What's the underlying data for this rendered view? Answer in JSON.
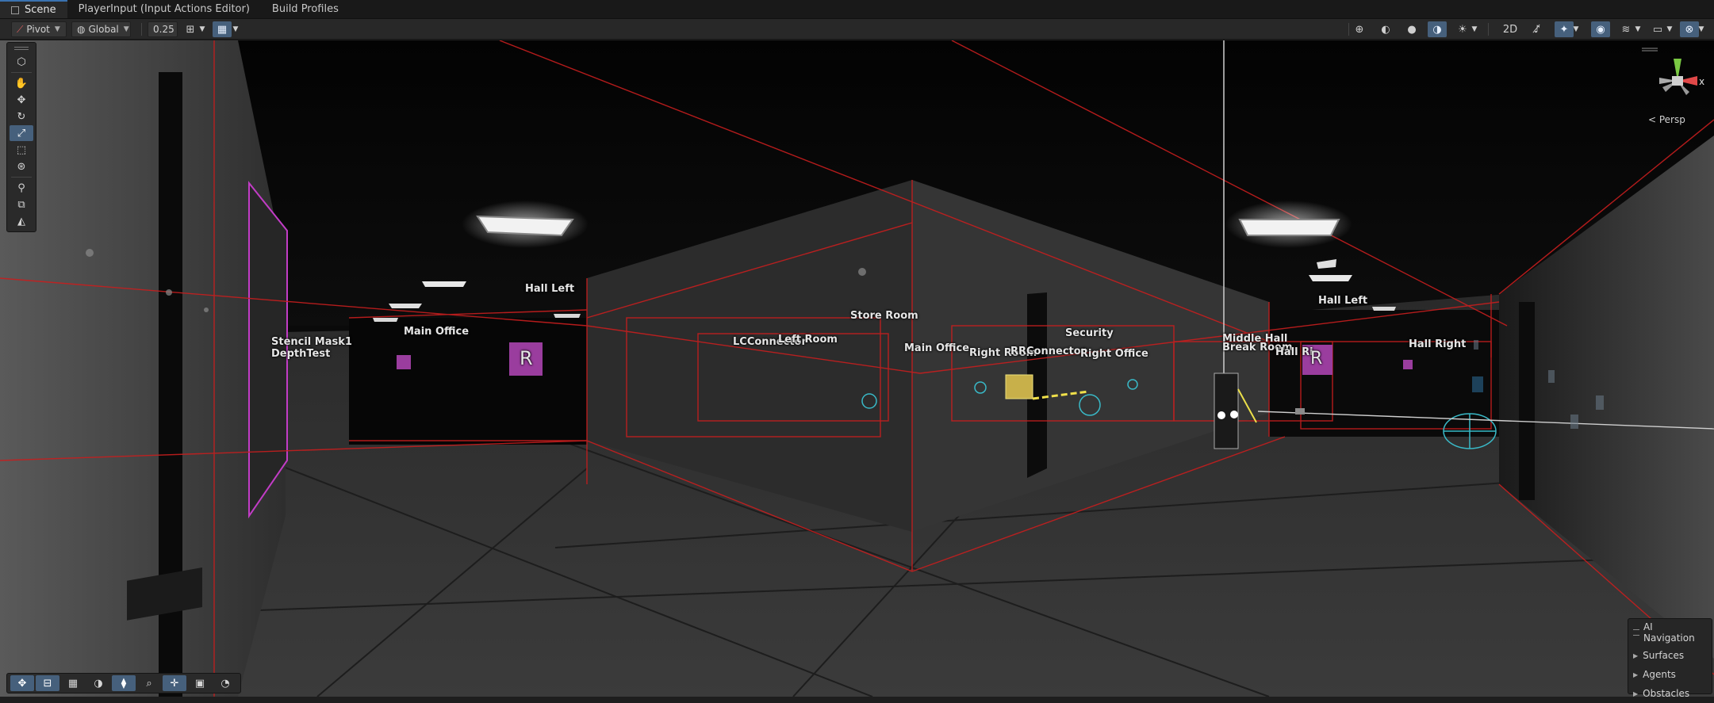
{
  "tabs": [
    {
      "label": "Scene",
      "active": true
    },
    {
      "label": "PlayerInput (Input Actions Editor)",
      "active": false
    },
    {
      "label": "Build Profiles",
      "active": false
    }
  ],
  "toolbar": {
    "pivot_label": "Pivot",
    "global_label": "Global",
    "snap_value": "0.25"
  },
  "scene": {
    "room_labels": [
      {
        "text": "Stencil Mask1\nDepthTest"
      },
      {
        "text": "Main Office"
      },
      {
        "text": "Hall Left"
      },
      {
        "text": "Store Room"
      },
      {
        "text": "LCConnector"
      },
      {
        "text": "Left Room"
      },
      {
        "text": "Main Office"
      },
      {
        "text": "Right Room"
      },
      {
        "text": "RRConnector"
      },
      {
        "text": "Security"
      },
      {
        "text": "Right Office"
      },
      {
        "text": "Middle Hall"
      },
      {
        "text": "Break Room"
      },
      {
        "text": "Hall Ri"
      },
      {
        "text": "Hall Left"
      },
      {
        "text": "Hall Right"
      }
    ],
    "markers": [
      "R",
      "R"
    ]
  },
  "gizmo": {
    "x_axis": "x",
    "view_mode": "< Persp"
  },
  "ai_navigation": {
    "title": "AI Navigation",
    "items": [
      "Surfaces",
      "Agents",
      "Obstacles"
    ]
  },
  "colors": {
    "accent": "#46607c",
    "volume_lines": "#c81e1e",
    "marker": "#9a3d9e"
  }
}
